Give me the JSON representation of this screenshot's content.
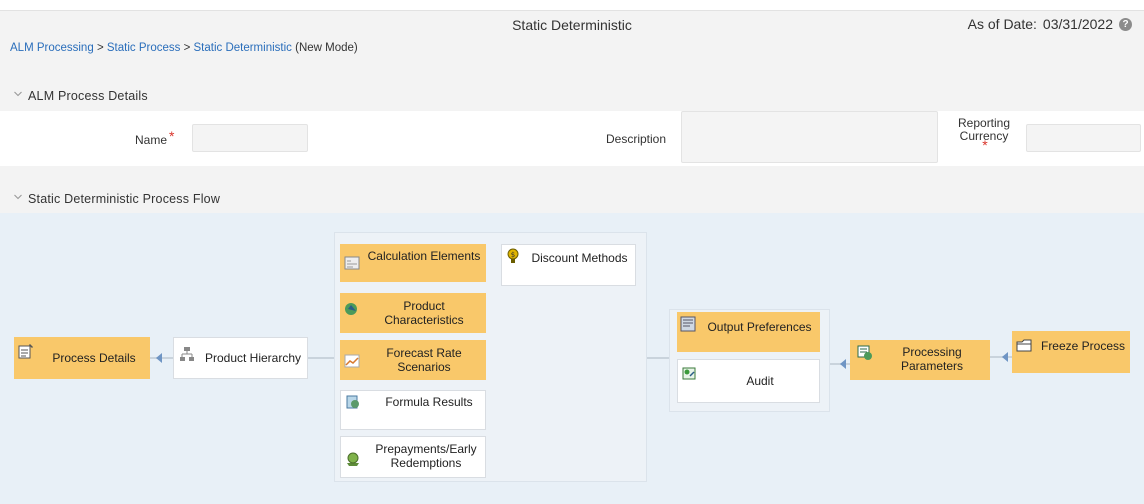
{
  "header": {
    "title": "Static Deterministic",
    "as_of_label": "As of Date:",
    "as_of_value": "03/31/2022",
    "help_glyph": "?"
  },
  "breadcrumb": {
    "items": [
      "ALM Processing",
      "Static Process",
      "Static Deterministic"
    ],
    "separator": ">",
    "mode": "(New Mode)"
  },
  "details": {
    "section_title": "ALM Process Details",
    "name_label": "Name",
    "name_value": "",
    "description_label": "Description",
    "description_value": "",
    "currency_label_line1": "Reporting",
    "currency_label_line2": "Currency",
    "currency_value": "",
    "required_mark": "*"
  },
  "flow": {
    "section_title": "Static Deterministic Process Flow",
    "nodes": {
      "process_details": "Process Details",
      "product_hierarchy": "Product Hierarchy",
      "calculation_elements": "Calculation Elements",
      "discount_methods": "Discount Methods",
      "product_characteristics": "Product Characteristics",
      "forecast_rate_scenarios": "Forecast Rate Scenarios",
      "formula_results": "Formula Results",
      "prepayments": "Prepayments/Early Redemptions",
      "output_preferences": "Output Preferences",
      "audit": "Audit",
      "processing_parameters": "Processing Parameters",
      "freeze_process": "Freeze Process"
    }
  },
  "colors": {
    "link": "#2a6ebb",
    "node_active": "#f9c86a",
    "flow_bg": "#e8f0f7",
    "required": "#d9342b"
  }
}
